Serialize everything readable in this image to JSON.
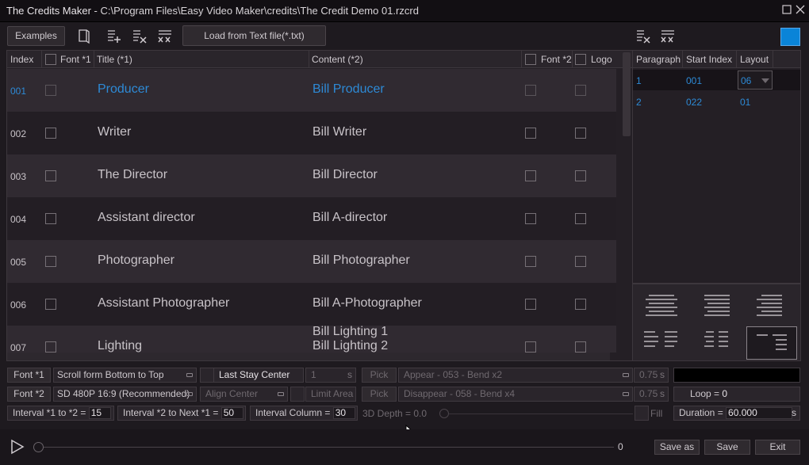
{
  "window": {
    "app_name": "The Credits Maker",
    "separator": " - ",
    "file_path": "C:\\Program Files\\Easy Video Maker\\credits\\The Credit Demo 01.rzcrd"
  },
  "toolbar": {
    "examples_label": "Examples",
    "load_label": "Load from Text file(*.txt)",
    "accent_color": "#0a84d8"
  },
  "grid": {
    "headers": {
      "index": "Index",
      "font1": "Font *1",
      "title": "Title (*1)",
      "content": "Content (*2)",
      "font2": "Font *2",
      "logo": "Logo"
    },
    "rows": [
      {
        "index": "001",
        "title": "Producer",
        "content": "Bill Producer",
        "selected": true
      },
      {
        "index": "002",
        "title": "Writer",
        "content": "Bill Writer"
      },
      {
        "index": "003",
        "title": "The Director",
        "content": "Bill Director"
      },
      {
        "index": "004",
        "title": "Assistant director",
        "content": "Bill A-director"
      },
      {
        "index": "005",
        "title": "Photographer",
        "content": "Bill Photographer"
      },
      {
        "index": "006",
        "title": "Assistant Photographer",
        "content": "Bill A-Photographer"
      },
      {
        "index": "007",
        "title": "Lighting",
        "content": "Bill Lighting 1",
        "content2": "Bill Lighting 2"
      }
    ]
  },
  "paragraphs": {
    "headers": {
      "paragraph": "Paragraph",
      "start_index": "Start Index",
      "layout": "Layout"
    },
    "rows": [
      {
        "paragraph": "1",
        "start_index": "001",
        "layout": "06"
      },
      {
        "paragraph": "2",
        "start_index": "022",
        "layout": "01"
      }
    ]
  },
  "controls": {
    "font1_label": "Font *1",
    "font2_label": "Font *2",
    "scroll_mode": "Scroll form Bottom to Top",
    "resolution": "SD 480P 16:9 (Recommended)",
    "last_stay": "Last Stay Center",
    "align": "Align Center",
    "stay_value": "1",
    "stay_unit": "s",
    "limit_area": "Limit Area",
    "pick1": "Pick",
    "pick2": "Pick",
    "appear": "Appear - 053 - Bend x2",
    "disappear": "Disappear - 058 - Bend x4",
    "appear_time": "0.75",
    "disappear_time": "0.75",
    "time_unit": "s",
    "loop_label": "Loop =",
    "loop_value": "0",
    "interval1_label": "Interval *1 to *2 =",
    "interval1_value": "15",
    "interval2_label": "Interval *2 to Next *1 =",
    "interval2_value": "50",
    "interval_col_label": "Interval Column =",
    "interval_col_value": "30",
    "depth_label": "3D Depth = 0.0",
    "fill_label": "Fill",
    "duration_label": "Duration =",
    "duration_value": "60.000",
    "duration_unit": "s"
  },
  "playback": {
    "position": "0",
    "save_as": "Save as",
    "save": "Save",
    "exit": "Exit"
  }
}
